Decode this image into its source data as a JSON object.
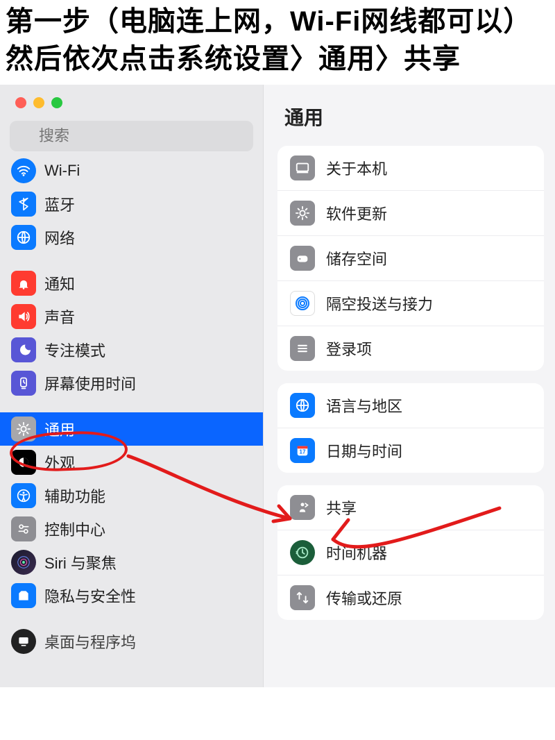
{
  "instruction_text": "第一步（电脑连上网，Wi-Fi网线都可以）然后依次点击系统设置〉通用〉共享",
  "search": {
    "placeholder": "搜索"
  },
  "sidebar": {
    "items": [
      {
        "label": "Wi-Fi",
        "icon": "wifi-icon",
        "bg": "#0a7aff"
      },
      {
        "label": "蓝牙",
        "icon": "bluetooth-icon",
        "bg": "#0a7aff"
      },
      {
        "label": "网络",
        "icon": "network-icon",
        "bg": "#0a7aff"
      },
      {
        "label": "通知",
        "icon": "notifications-icon",
        "bg": "#ff3b30"
      },
      {
        "label": "声音",
        "icon": "sound-icon",
        "bg": "#ff3b30"
      },
      {
        "label": "专注模式",
        "icon": "focus-icon",
        "bg": "#5856d6"
      },
      {
        "label": "屏幕使用时间",
        "icon": "screen-time-icon",
        "bg": "#5856d6"
      },
      {
        "label": "通用",
        "icon": "general-icon",
        "bg": "#8e8e93"
      },
      {
        "label": "外观",
        "icon": "appearance-icon",
        "bg": "#000"
      },
      {
        "label": "辅助功能",
        "icon": "accessibility-icon",
        "bg": "#0a7aff"
      },
      {
        "label": "控制中心",
        "icon": "control-center-icon",
        "bg": "#8e8e93"
      },
      {
        "label": "Siri 与聚焦",
        "icon": "siri-icon",
        "bg": "#222"
      },
      {
        "label": "隐私与安全性",
        "icon": "privacy-icon",
        "bg": "#0a7aff"
      },
      {
        "label": "桌面与程序坞",
        "icon": "desktop-icon",
        "bg": "#000"
      }
    ]
  },
  "content": {
    "title": "通用",
    "groups": [
      [
        {
          "label": "关于本机",
          "icon": "about-icon",
          "bg": "#8e8e93"
        },
        {
          "label": "软件更新",
          "icon": "software-update-icon",
          "bg": "#8e8e93"
        },
        {
          "label": "储存空间",
          "icon": "storage-icon",
          "bg": "#8e8e93"
        },
        {
          "label": "隔空投送与接力",
          "icon": "airdrop-icon",
          "bg": "#fff"
        },
        {
          "label": "登录项",
          "icon": "login-items-icon",
          "bg": "#8e8e93"
        }
      ],
      [
        {
          "label": "语言与地区",
          "icon": "language-icon",
          "bg": "#0a7aff"
        },
        {
          "label": "日期与时间",
          "icon": "date-time-icon",
          "bg": "#0a7aff"
        }
      ],
      [
        {
          "label": "共享",
          "icon": "sharing-icon",
          "bg": "#8e8e93"
        },
        {
          "label": "时间机器",
          "icon": "time-machine-icon",
          "bg": "#111"
        },
        {
          "label": "传输或还原",
          "icon": "transfer-icon",
          "bg": "#8e8e93"
        }
      ]
    ]
  }
}
